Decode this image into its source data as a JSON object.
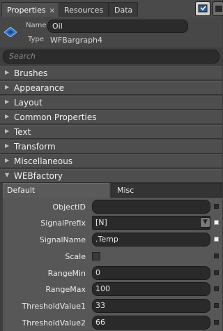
{
  "tabs": [
    {
      "label": "Properties",
      "active": true
    },
    {
      "label": "Resources",
      "active": false
    },
    {
      "label": "Data",
      "active": false
    }
  ],
  "tab_close_glyph": "×",
  "toolbar": {
    "icons": [
      "events-view-icon",
      "properties-view-icon"
    ]
  },
  "header": {
    "name_label": "Name",
    "name_value": "Oil",
    "type_label": "Type",
    "type_value": "WFBargraph4",
    "icon": "object-diamond-icon"
  },
  "search": {
    "placeholder": "Search"
  },
  "categories": [
    {
      "label": "Brushes",
      "expanded": false
    },
    {
      "label": "Appearance",
      "expanded": false
    },
    {
      "label": "Layout",
      "expanded": false
    },
    {
      "label": "Common Properties",
      "expanded": false
    },
    {
      "label": "Text",
      "expanded": false
    },
    {
      "label": "Transform",
      "expanded": false
    },
    {
      "label": "Miscellaneous",
      "expanded": false
    },
    {
      "label": "WEBfactory",
      "expanded": true
    }
  ],
  "subtabs": {
    "default_label": "Default",
    "misc_label": "Misc"
  },
  "properties": [
    {
      "label": "ObjectID",
      "value": ""
    },
    {
      "label": "SignalPrefix",
      "value": "[N]"
    },
    {
      "label": "SignalName",
      "value": ".Temp"
    },
    {
      "label": "Scale",
      "value": ""
    },
    {
      "label": "RangeMin",
      "value": "0"
    },
    {
      "label": "RangeMax",
      "value": "100"
    },
    {
      "label": "ThresholdValue1",
      "value": "33"
    },
    {
      "label": "ThresholdValue2",
      "value": "66"
    }
  ],
  "colors": {
    "accent": "#2b73c9",
    "background": "#3d3d3d",
    "input": "#2a2a2a"
  }
}
